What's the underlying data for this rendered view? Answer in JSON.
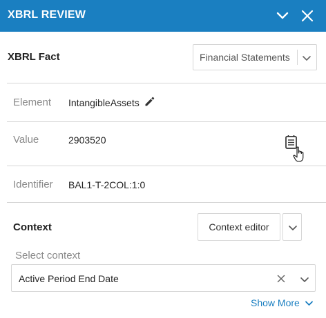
{
  "header": {
    "title": "XBRL REVIEW",
    "collapse_icon": "chevron-down-icon",
    "close_icon": "close-icon",
    "background": "#1a7fc1"
  },
  "fact": {
    "title": "XBRL Fact",
    "view_select": {
      "value": "Financial Statements"
    }
  },
  "rows": {
    "element": {
      "label": "Element",
      "value": "IntangibleAssets",
      "icon": "pencil-icon"
    },
    "value": {
      "label": "Value",
      "value": "2903520",
      "icon": "document-list-icon"
    },
    "identifier": {
      "label": "Identifier",
      "value": "BAL1-T-2COL:1:0"
    }
  },
  "context": {
    "title": "Context",
    "editor_button": "Context editor",
    "select_label": "Select context",
    "select_value": "Active Period End Date",
    "show_more": "Show More"
  },
  "colors": {
    "accent": "#1a7fc1",
    "border": "#d6d6d6",
    "muted": "#8a8a8a"
  }
}
